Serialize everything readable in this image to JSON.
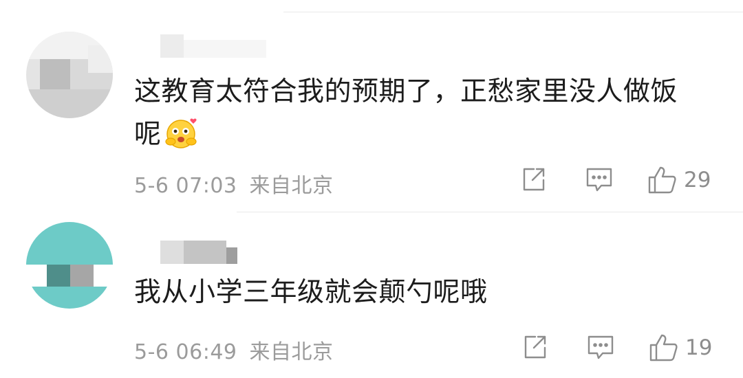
{
  "comments": [
    {
      "text_line1": "这教育太符合我的预期了，正愁家里没人做饭",
      "text_line2": "呢",
      "emoji_icon": "hugging-smile-emoji",
      "date": "5-6 07:03",
      "location": "来自北京",
      "likes": "29",
      "avatar_colors": [
        "#c9c9c9",
        "#e6e6e6",
        "#b0b0b0"
      ]
    },
    {
      "text_line1": "我从小学三年级就会颠勺呢哦",
      "date": "5-6 06:49",
      "location": "来自北京",
      "likes": "19",
      "avatar_colors": [
        "#6dcbc7",
        "#4fa9a4",
        "#9a9a9a"
      ]
    }
  ],
  "actions": {
    "share_icon": "share-icon",
    "comment_icon": "comment-icon",
    "like_icon": "thumbs-up-icon"
  },
  "colors": {
    "text": "#1c1c1c",
    "meta": "#9b9b9b",
    "divider": "#e9e9e9",
    "icon": "#8d8d8d"
  }
}
